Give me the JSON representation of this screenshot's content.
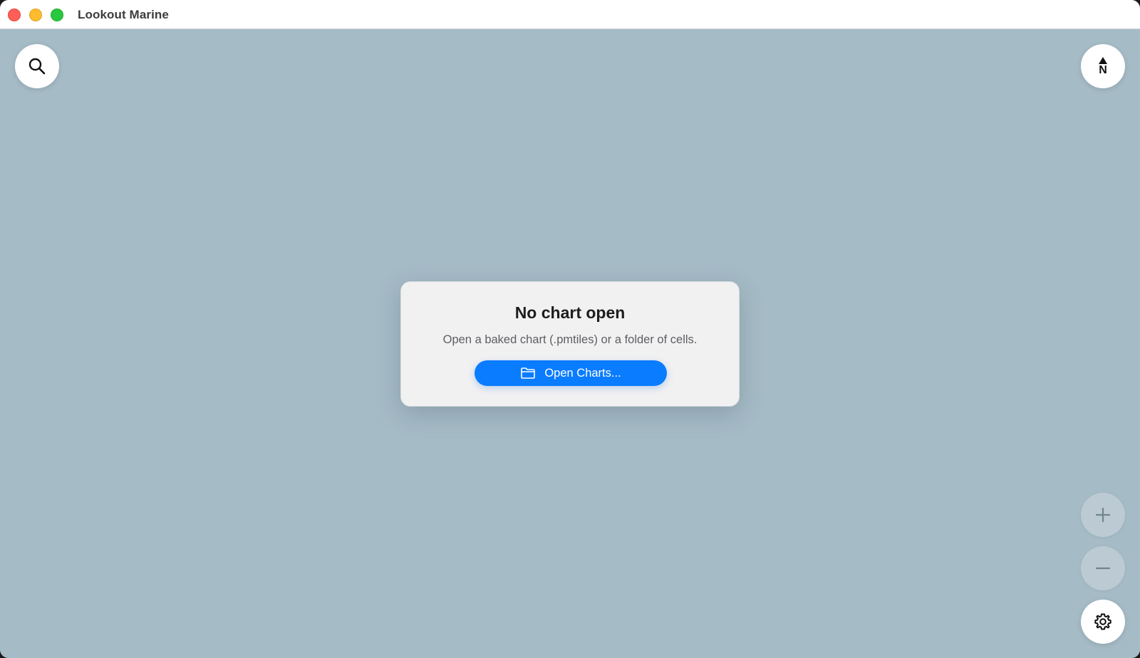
{
  "window": {
    "title": "Lookout Marine"
  },
  "map_controls": {
    "search_icon": "search-icon",
    "north_label": "N",
    "zoom_in_icon": "plus-icon",
    "zoom_out_icon": "minus-icon",
    "settings_icon": "gear-icon"
  },
  "empty_state": {
    "title": "No chart open",
    "subtitle": "Open a baked chart (.pmtiles) or a folder of cells.",
    "open_button_label": "Open Charts...",
    "open_button_icon": "folder-icon"
  },
  "colors": {
    "map_background": "#a5bbc6",
    "accent": "#0a7cff",
    "close": "#ff5f57",
    "minimize": "#febc2e",
    "maximize": "#28c840"
  }
}
